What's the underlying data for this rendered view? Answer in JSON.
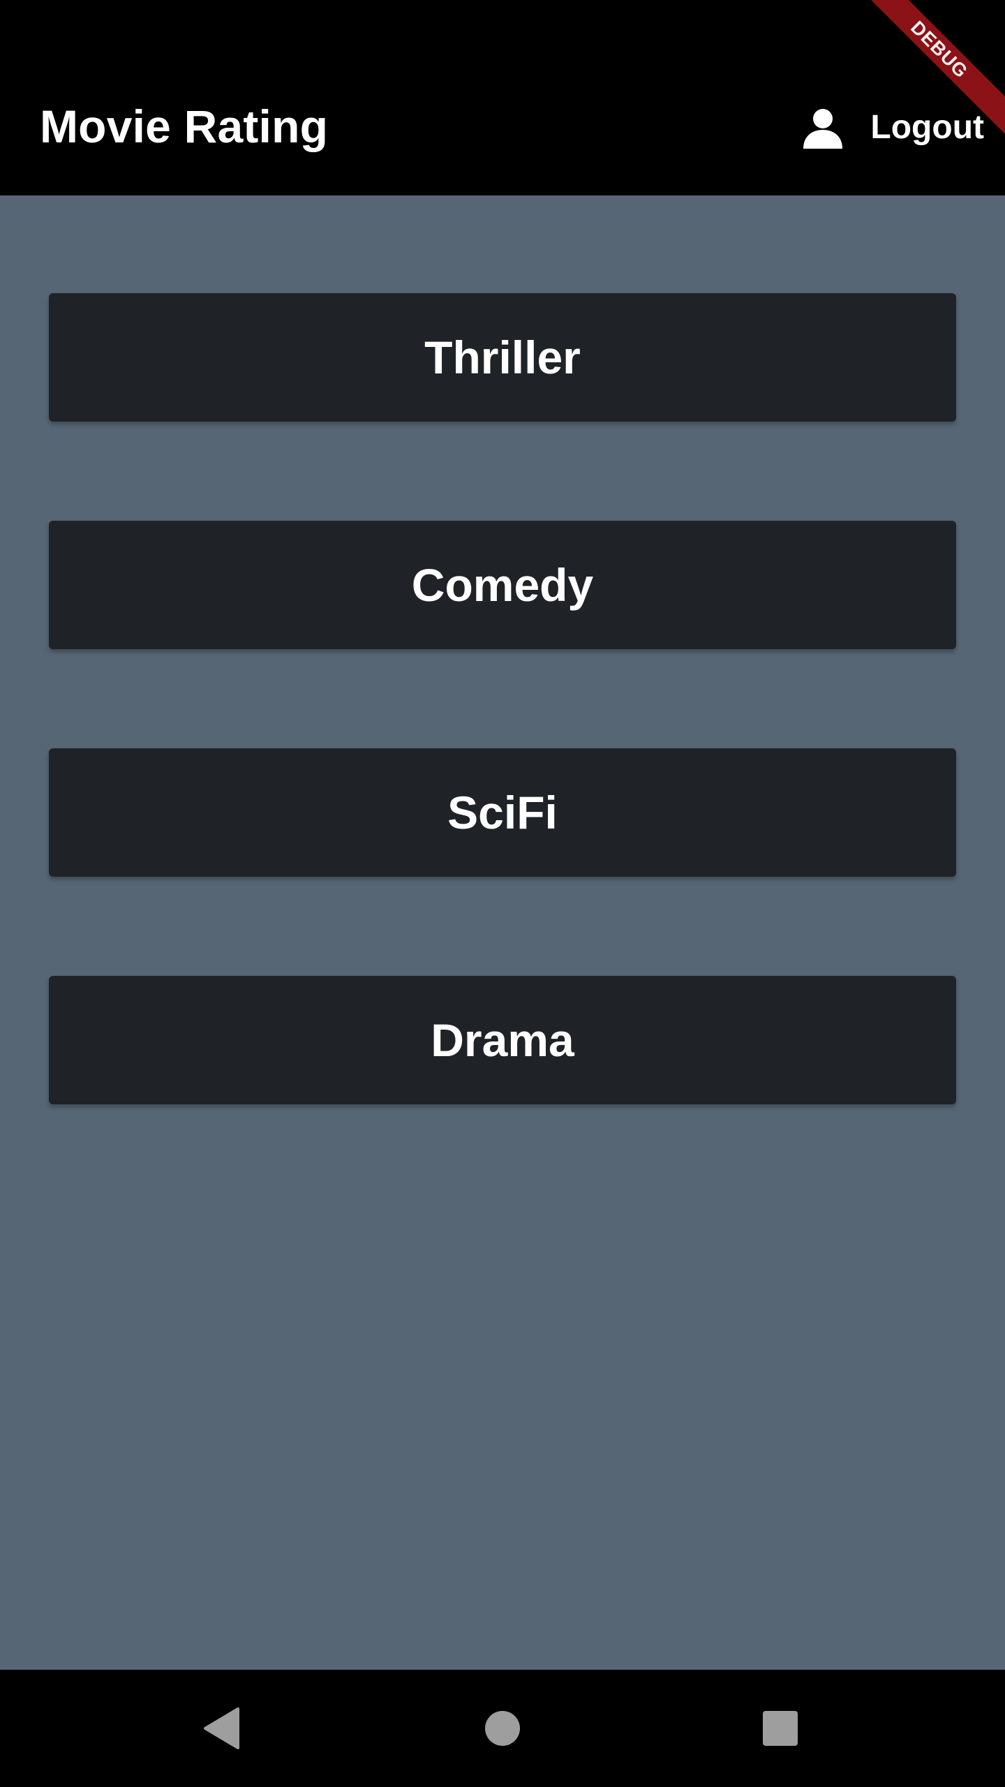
{
  "appbar": {
    "title": "Movie Rating",
    "logout_label": "Logout",
    "logout_icon": "person-icon",
    "debug_label": "DEBUG",
    "background_color": "#000000",
    "debug_color": "#8b1216"
  },
  "genres": [
    {
      "label": "Thriller"
    },
    {
      "label": "Comedy"
    },
    {
      "label": "SciFi"
    },
    {
      "label": "Drama"
    }
  ],
  "theme": {
    "content_background": "#566674",
    "button_background": "#1f2327",
    "text_color": "#ffffff",
    "system_icon_color": "#9e9e9e"
  },
  "system_nav": {
    "back_icon": "back-triangle-icon",
    "home_icon": "home-circle-icon",
    "recents_icon": "recents-square-icon"
  }
}
